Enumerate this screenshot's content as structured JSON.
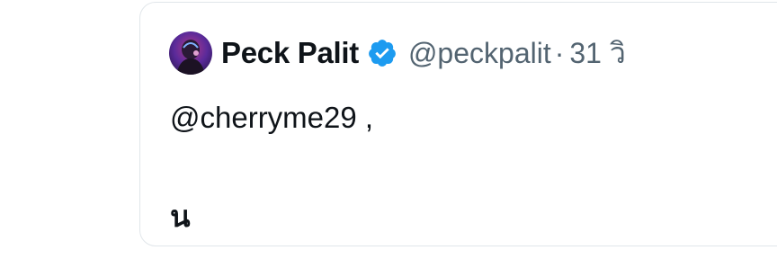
{
  "tweet": {
    "author": {
      "display_name": "Peck Palit",
      "handle": "@peckpalit",
      "avatar_icon": "avatar-image",
      "verified_icon": "verified-badge-icon",
      "verified_color": "#1d9bf0"
    },
    "separator": "·",
    "time": "31 วิ",
    "text_lines": [
      "@cherryme29 ,",
      "น"
    ]
  },
  "colors": {
    "name_text": "#0f1419",
    "secondary_text": "#536471",
    "border": "#e1e6ea"
  }
}
